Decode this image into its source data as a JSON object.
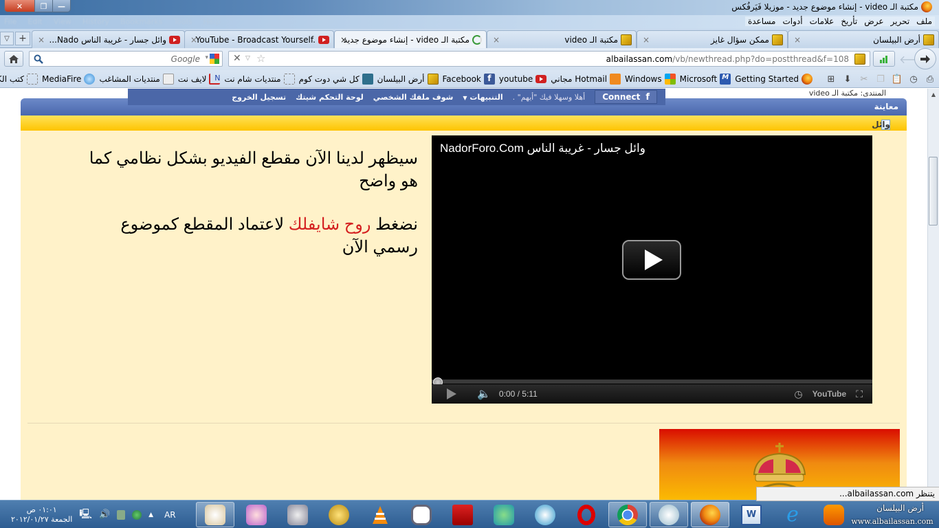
{
  "window": {
    "title": "مكتبة الـ video - إنشاء موضوع جديد - موزيلا فَيَرفُكس",
    "controls": {
      "close": "✕",
      "restore": "❐",
      "minimize": "—"
    }
  },
  "menu": {
    "items": [
      "ملف",
      "تحرير",
      "عرض",
      "تأريخ",
      "علامات",
      "أدوات",
      "مساعدة"
    ]
  },
  "tabs": [
    {
      "label": "أرض البيلسان",
      "icon": "albailassan-icon",
      "active": false
    },
    {
      "label": "ممكن سؤال غايز",
      "icon": "albailassan-icon",
      "active": false
    },
    {
      "label": "مكتبة الـ video",
      "icon": "albailassan-icon",
      "active": false
    },
    {
      "label": "مكتبة الـ video - إنشاء موضوع جديد",
      "icon": "loading-icon",
      "active": true
    },
    {
      "label": "YouTube - Broadcast Yourself.",
      "icon": "youtube-icon",
      "active": false
    },
    {
      "label": "وائل جسار - غريبة الناس Nado...",
      "icon": "youtube-icon",
      "active": false
    }
  ],
  "tabbar": {
    "new_tab": "+",
    "list_all": "▽",
    "close": "×"
  },
  "navbar": {
    "search_placeholder": "Google",
    "url_domain": "albailassan.com",
    "url_path": "/vb/newthread.php?do=postthread&f=108"
  },
  "bookmarks": [
    {
      "label": "Getting Started",
      "icon": "firefox-icon"
    },
    {
      "label": "Microsoft",
      "icon": "msn-icon"
    },
    {
      "label": "Windows",
      "icon": "windows-icon"
    },
    {
      "label": "Hotmail مجاني",
      "icon": "hotmail-icon"
    },
    {
      "label": "youtube",
      "icon": "youtube-icon"
    },
    {
      "label": "Facebook",
      "icon": "facebook-icon"
    },
    {
      "label": "أرض البيلسان",
      "icon": "albailassan-icon"
    },
    {
      "label": "كل شي دوت كوم",
      "icon": "site-icon"
    },
    {
      "label": "منتديات شام نت",
      "icon": "blank-icon"
    },
    {
      "label": "لايف نت",
      "icon": "livenet-icon"
    },
    {
      "label": "منتديات المشاغب",
      "icon": "page-icon"
    },
    {
      "label": "MediaFire",
      "icon": "mediafire-icon"
    },
    {
      "label": "كتب الكترونية مهمة",
      "icon": "blank-icon"
    }
  ],
  "forum": {
    "path": "المنتدى: مكتبة الـ video",
    "fb_connect": "Connect",
    "welcome": "أهلا وسهلا فيك \"أيهم\" .",
    "alerts": "التنبيهات",
    "profile": "شوف ملفك الشخصي",
    "control_panel": "لوحة التحكم شيتك",
    "logout": "تسجيل الخروج",
    "preview_header": "معاينة",
    "thread_title": "وائل جسار - غريبة الناس",
    "post": {
      "para1": "سيظهر لدينا الآن مقطع الفيديو بشكل نظامي كما هو واضح",
      "para2_before": "نضغط ",
      "para2_link": "روح شايفلك",
      "para2_after": " لاعتماد المقطع كموضوع رسمي الآن"
    },
    "video": {
      "title": "NadorForo.Com   وائل جسار - غريبة الناس",
      "time": "0:00 / 5:11",
      "progress_fraction": 0,
      "brand": "YouTube"
    }
  },
  "status": "يتنظر albailassan.com...",
  "taskbar": {
    "language": "AR",
    "time": "٠١:٠١ ص",
    "date": "الجمعة ٢٠١٢/٠١/٢٧",
    "apps": [
      "paint",
      "snipping-tool",
      "utility",
      "alrafi",
      "vlc",
      "app",
      "acrobat",
      "messenger",
      "safari",
      "opera",
      "chrome",
      "gadget",
      "firefox",
      "word",
      "internet-explorer",
      "media-player"
    ],
    "brand_line1": "أرض البيلسان",
    "brand_line2": "www.albailassan.com"
  }
}
